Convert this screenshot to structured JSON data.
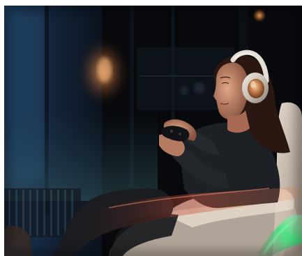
{
  "photo": {
    "subject": "woman-with-headphones-holding-game-controller",
    "colors": {
      "background": "#07090d",
      "window_blue": "#1b3350",
      "lamp_glow": "#f0a25a",
      "headphone_silver": "#d8d2cc",
      "headphone_copper": "#c07a48",
      "chair_cream": "#e8dccd",
      "reflection_red": "#c8463a",
      "reflection_green": "#35e07a",
      "skin": "#c98f76",
      "hair": "#2a1712",
      "sweater": "#1d2024"
    }
  }
}
